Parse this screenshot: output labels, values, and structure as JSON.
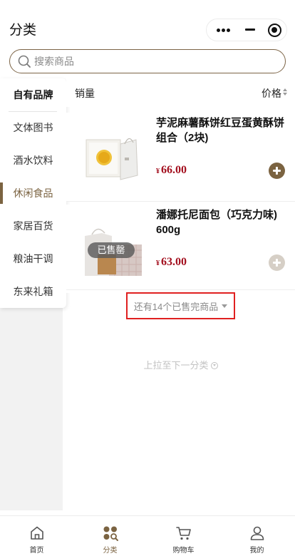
{
  "header": {
    "title": "分类"
  },
  "capsule": {
    "more": "more-icon",
    "minimize": "minimize-icon",
    "close": "target-icon"
  },
  "search": {
    "placeholder": "搜索商品",
    "value": ""
  },
  "sidebar": {
    "items": [
      {
        "label": "自有品牌",
        "state": "heading"
      },
      {
        "label": "文体图书"
      },
      {
        "label": "酒水饮料"
      },
      {
        "label": "休闲食品",
        "state": "active"
      },
      {
        "label": "家居百货"
      },
      {
        "label": "粮油干调"
      },
      {
        "label": "东来礼箱"
      }
    ]
  },
  "sort": {
    "sales_label": "销量",
    "price_label": "价格"
  },
  "products": [
    {
      "name": "芋泥麻薯酥饼红豆蛋黄酥饼组合（2块)",
      "currency": "¥",
      "price": "66.00",
      "sold_out": false
    },
    {
      "name": "潘娜托尼面包（巧克力味) 600g",
      "currency": "¥",
      "price": "63.00",
      "sold_out": true,
      "badge": "已售罄"
    }
  ],
  "more_sold": {
    "label": "还有14个已售完商品"
  },
  "pull_next": {
    "label": "上拉至下一分类"
  },
  "tabbar": {
    "items": [
      {
        "label": "首页",
        "icon": "home-icon"
      },
      {
        "label": "分类",
        "icon": "category-icon",
        "state": "active"
      },
      {
        "label": "购物车",
        "icon": "cart-icon"
      },
      {
        "label": "我的",
        "icon": "user-icon"
      }
    ]
  },
  "colors": {
    "accent": "#7b6341",
    "price": "#a3101f",
    "highlight_box": "#e02020"
  }
}
